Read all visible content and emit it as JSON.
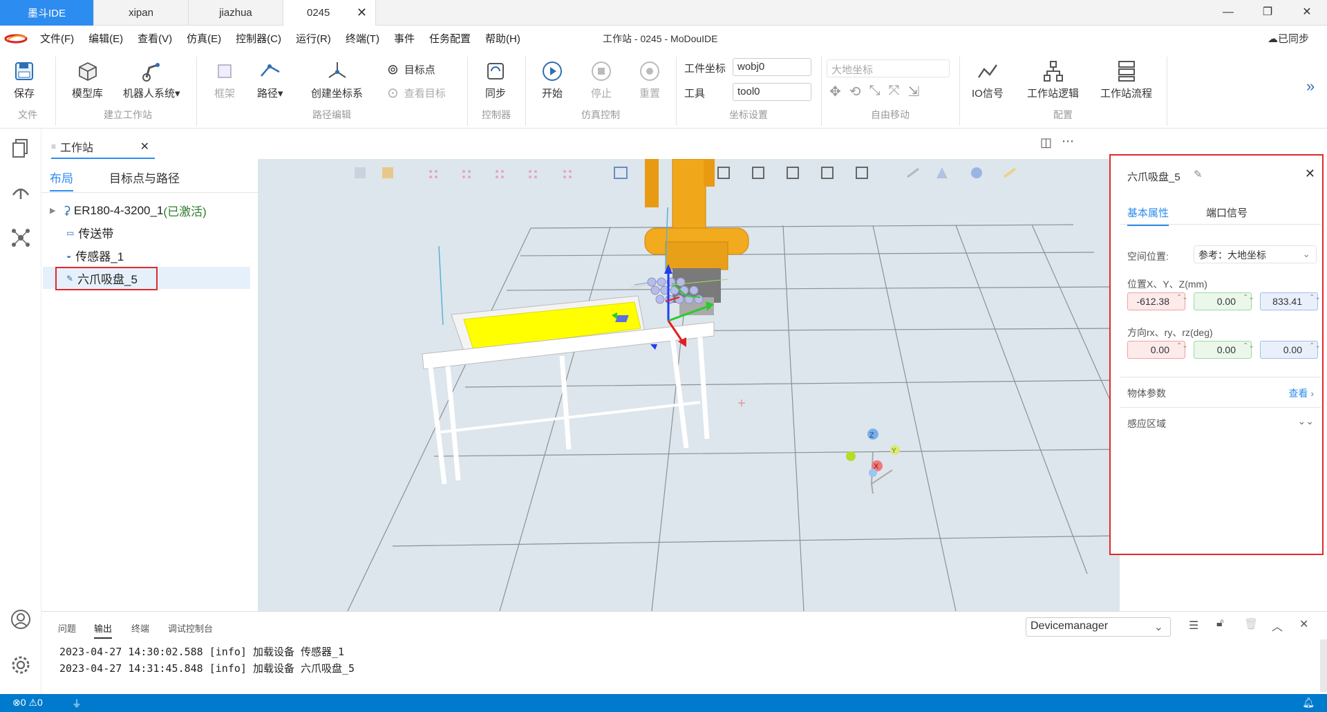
{
  "tabs": [
    {
      "label": "墨斗IDE"
    },
    {
      "label": "xipan"
    },
    {
      "label": "jiazhua"
    },
    {
      "label": "0245"
    }
  ],
  "window_title": "工作站 - 0245 - MoDouIDE",
  "sync_label": "已同步",
  "menu": [
    "文件(F)",
    "编辑(E)",
    "查看(V)",
    "仿真(E)",
    "控制器(C)",
    "运行(R)",
    "终端(T)",
    "事件",
    "任务配置",
    "帮助(H)"
  ],
  "ribbon": {
    "save": "保存",
    "model_lib": "模型库",
    "robot_system": "机器人系统▾",
    "frame": "框架",
    "path": "路径▾",
    "create_coord": "创建坐标系",
    "target_point": "目标点",
    "view_target": "查看目标",
    "sync": "同步",
    "start": "开始",
    "stop": "停止",
    "reset": "重置",
    "workobj_label": "工件坐标",
    "workobj_value": "wobj0",
    "tool_label": "工具",
    "tool_value": "tool0",
    "world_coord": "大地坐标",
    "io_signal": "IO信号",
    "station_logic": "工作站逻辑",
    "station_flow": "工作站流程",
    "groups": {
      "file": "文件",
      "build": "建立工作站",
      "path_edit": "路径编辑",
      "controller": "控制器",
      "sim": "仿真控制",
      "coord": "坐标设置",
      "free_move": "自由移动",
      "config": "配置"
    }
  },
  "explorer": {
    "tab": "工作站",
    "subtabs": [
      "布局",
      "目标点与路径"
    ],
    "items": [
      {
        "label": "ER180-4-3200_1",
        "status": "(已激活)"
      },
      {
        "label": "传送带"
      },
      {
        "label": "传感器_1"
      },
      {
        "label": "六爪吸盘_5"
      }
    ]
  },
  "props": {
    "title": "六爪吸盘_5",
    "tabs": [
      "基本属性",
      "端口信号"
    ],
    "space_label": "空间位置:",
    "space_value": "参考：大地坐标",
    "pos_label": "位置X、Y、Z(mm)",
    "pos": [
      "-612.38",
      "0.00",
      "833.41"
    ],
    "rot_label": "方向rx、ry、rz(deg)",
    "rot": [
      "0.00",
      "0.00",
      "0.00"
    ],
    "params_label": "物体参数",
    "view_link": "查看",
    "sense_label": "感应区域"
  },
  "bottom": {
    "tabs": [
      "问题",
      "输出",
      "终端",
      "调试控制台"
    ],
    "device": "Devicemanager",
    "logs": [
      "2023-04-27 14:30:02.588 [info] 加载设备 传感器_1",
      "2023-04-27 14:31:45.848 [info] 加载设备 六爪吸盘_5"
    ]
  },
  "status": {
    "errors": "0",
    "warnings": "0"
  },
  "colors": {
    "accent": "#2d8cf0",
    "status_bar": "#007acc",
    "highlight": "#e0282a",
    "active_green": "#2e7d32"
  }
}
